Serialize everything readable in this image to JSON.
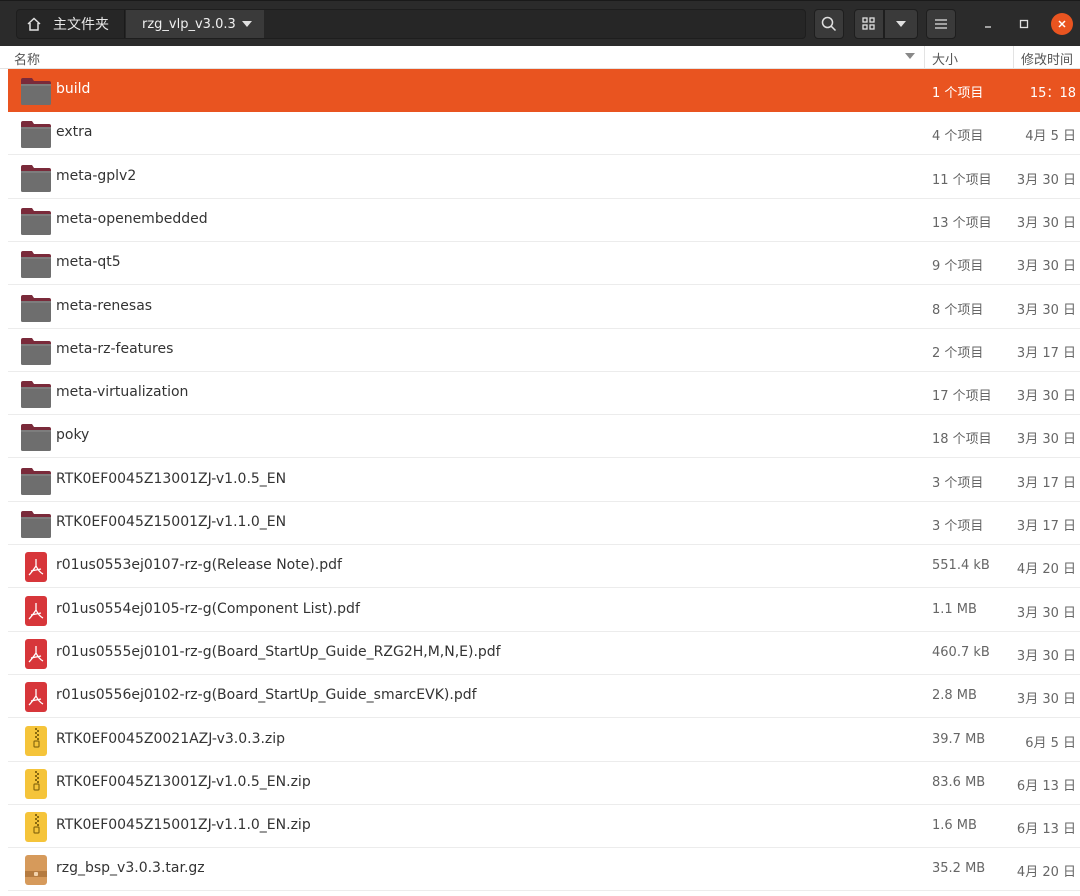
{
  "path": {
    "home_label": "主文件夹",
    "current_folder": "rzg_vlp_v3.0.3"
  },
  "columns": {
    "name": "名称",
    "size": "大小",
    "modified": "修改时间"
  },
  "colors": {
    "accent": "#e95420",
    "header_bg": "#2b2b2b",
    "folder": "#6e6e6e",
    "pdf": "#d7363a",
    "zip": "#f5c43a",
    "archive": "#d69a5b"
  },
  "files": [
    {
      "name": "build",
      "type": "folder",
      "size": "1 个项目",
      "modified": "15：18",
      "selected": true
    },
    {
      "name": "extra",
      "type": "folder",
      "size": "4 个项目",
      "modified": "4月 5 日"
    },
    {
      "name": "meta-gplv2",
      "type": "folder",
      "size": "11 个项目",
      "modified": "3月 30 日"
    },
    {
      "name": "meta-openembedded",
      "type": "folder",
      "size": "13 个项目",
      "modified": "3月 30 日"
    },
    {
      "name": "meta-qt5",
      "type": "folder",
      "size": "9 个项目",
      "modified": "3月 30 日"
    },
    {
      "name": "meta-renesas",
      "type": "folder",
      "size": "8 个项目",
      "modified": "3月 30 日"
    },
    {
      "name": "meta-rz-features",
      "type": "folder",
      "size": "2 个项目",
      "modified": "3月 17 日"
    },
    {
      "name": "meta-virtualization",
      "type": "folder",
      "size": "17 个项目",
      "modified": "3月 30 日"
    },
    {
      "name": "poky",
      "type": "folder",
      "size": "18 个项目",
      "modified": "3月 30 日"
    },
    {
      "name": "RTK0EF0045Z13001ZJ-v1.0.5_EN",
      "type": "folder",
      "size": "3 个项目",
      "modified": "3月 17 日"
    },
    {
      "name": "RTK0EF0045Z15001ZJ-v1.1.0_EN",
      "type": "folder",
      "size": "3 个项目",
      "modified": "3月 17 日"
    },
    {
      "name": "r01us0553ej0107-rz-g(Release Note).pdf",
      "type": "pdf",
      "size": "551.4 kB",
      "modified": "4月 20 日"
    },
    {
      "name": "r01us0554ej0105-rz-g(Component List).pdf",
      "type": "pdf",
      "size": "1.1 MB",
      "modified": "3月 30 日"
    },
    {
      "name": "r01us0555ej0101-rz-g(Board_StartUp_Guide_RZG2H,M,N,E).pdf",
      "type": "pdf",
      "size": "460.7 kB",
      "modified": "3月 30 日"
    },
    {
      "name": "r01us0556ej0102-rz-g(Board_StartUp_Guide_smarcEVK).pdf",
      "type": "pdf",
      "size": "2.8 MB",
      "modified": "3月 30 日"
    },
    {
      "name": "RTK0EF0045Z0021AZJ-v3.0.3.zip",
      "type": "zip",
      "size": "39.7 MB",
      "modified": "6月 5 日"
    },
    {
      "name": "RTK0EF0045Z13001ZJ-v1.0.5_EN.zip",
      "type": "zip",
      "size": "83.6 MB",
      "modified": "6月 13 日"
    },
    {
      "name": "RTK0EF0045Z15001ZJ-v1.1.0_EN.zip",
      "type": "zip",
      "size": "1.6 MB",
      "modified": "6月 13 日"
    },
    {
      "name": "rzg_bsp_v3.0.3.tar.gz",
      "type": "archive",
      "size": "35.2 MB",
      "modified": "4月 20 日"
    }
  ]
}
